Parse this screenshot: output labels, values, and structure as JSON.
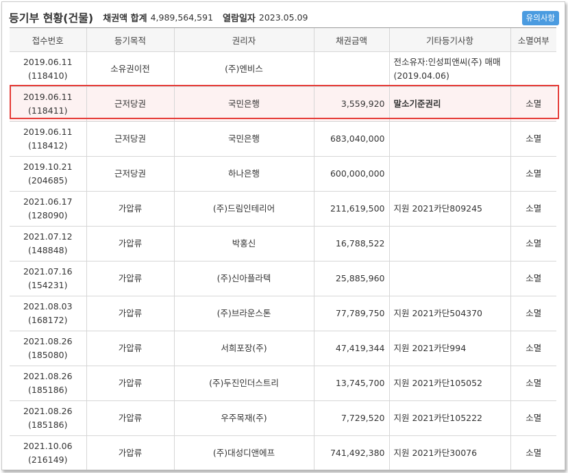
{
  "header": {
    "title": "등기부 현황(건물)",
    "total_label": "채권액 합계",
    "total_value": "4,989,564,591",
    "date_label": "열람일자",
    "date_value": "2023.05.09",
    "notice_button": "유의사항"
  },
  "columns": [
    "접수번호",
    "등기목적",
    "권리자",
    "채권금액",
    "기타등기사항",
    "소멸여부"
  ],
  "rows": [
    {
      "date": "2019.06.11",
      "no": "(118410)",
      "purpose": "소유권이전",
      "holder": "(주)엔비스",
      "amount": "",
      "note": "전소유자:인성피앤씨(주) 매매(2019.04.06)",
      "extinct": ""
    },
    {
      "date": "2019.06.11",
      "no": "(118411)",
      "purpose": "근저당권",
      "holder": "국민은행",
      "amount": "3,559,920",
      "note": "말소기준권리",
      "extinct": "소멸"
    },
    {
      "date": "2019.06.11",
      "no": "(118412)",
      "purpose": "근저당권",
      "holder": "국민은행",
      "amount": "683,040,000",
      "note": "",
      "extinct": "소멸"
    },
    {
      "date": "2019.10.21",
      "no": "(204685)",
      "purpose": "근저당권",
      "holder": "하나은행",
      "amount": "600,000,000",
      "note": "",
      "extinct": "소멸"
    },
    {
      "date": "2021.06.17",
      "no": "(128090)",
      "purpose": "가압류",
      "holder": "(주)드림인테리어",
      "amount": "211,619,500",
      "note": "지원 2021카단809245",
      "extinct": "소멸"
    },
    {
      "date": "2021.07.12",
      "no": "(148848)",
      "purpose": "가압류",
      "holder": "박홍신",
      "amount": "16,788,522",
      "note": "",
      "extinct": "소멸"
    },
    {
      "date": "2021.07.16",
      "no": "(154231)",
      "purpose": "가압류",
      "holder": "(주)신아플라텍",
      "amount": "25,885,960",
      "note": "",
      "extinct": "소멸"
    },
    {
      "date": "2021.08.03",
      "no": "(168172)",
      "purpose": "가압류",
      "holder": "(주)브라운스톤",
      "amount": "77,789,750",
      "note": "지원 2021카단504370",
      "extinct": "소멸"
    },
    {
      "date": "2021.08.26",
      "no": "(185080)",
      "purpose": "가압류",
      "holder": "서희포장(주)",
      "amount": "47,419,344",
      "note": "지원 2021카단994",
      "extinct": "소멸"
    },
    {
      "date": "2021.08.26",
      "no": "(185186)",
      "purpose": "가압류",
      "holder": "(주)두진인더스트리",
      "amount": "13,745,700",
      "note": "지원 2021카단105052",
      "extinct": "소멸"
    },
    {
      "date": "2021.08.26",
      "no": "(185186)",
      "purpose": "가압류",
      "holder": "우주목재(주)",
      "amount": "7,729,520",
      "note": "지원 2021카단105222",
      "extinct": "소멸"
    },
    {
      "date": "2021.10.06",
      "no": "(216149)",
      "purpose": "가압류",
      "holder": "(주)대성디앤에프",
      "amount": "741,492,380",
      "note": "지원 2021카단30076",
      "extinct": "소멸"
    }
  ],
  "highlight_row_index": 1,
  "colors": {
    "accent": "#4a9be0",
    "highlight_border": "#e53935",
    "header_bg": "#f6f6f6"
  }
}
